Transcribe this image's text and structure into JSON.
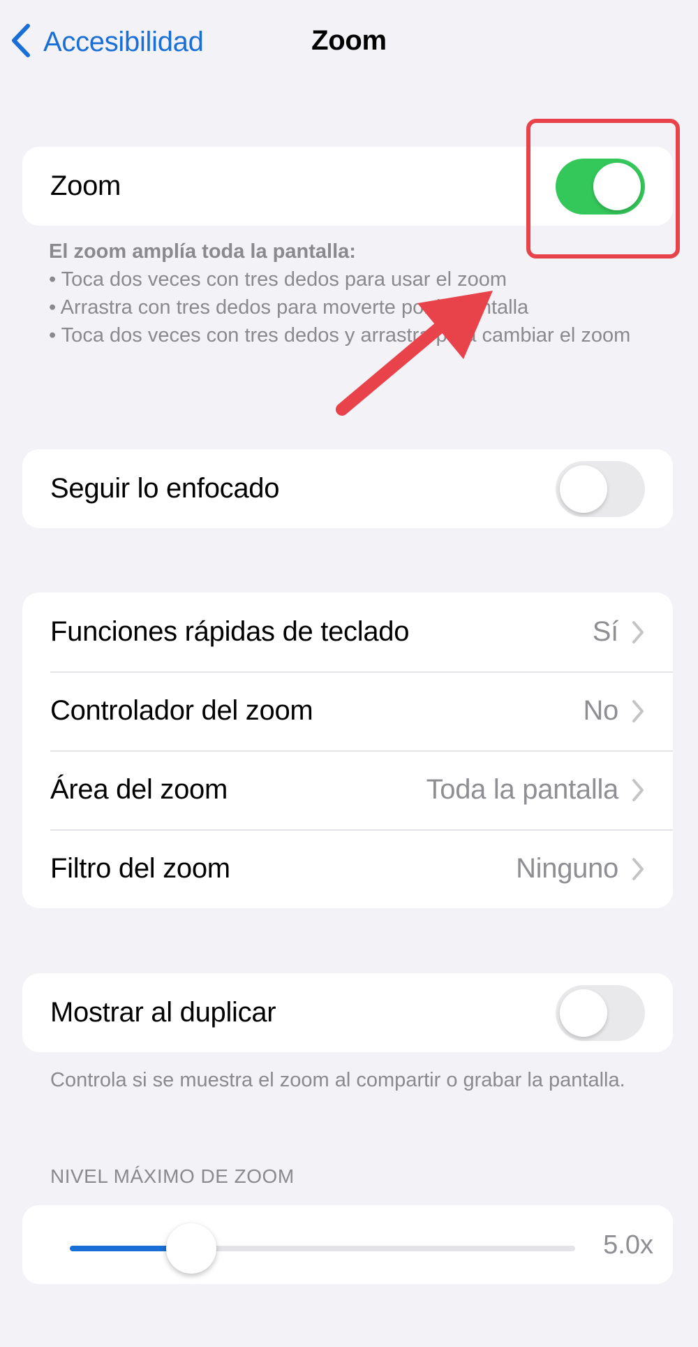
{
  "navbar": {
    "back_label": "Accesibilidad",
    "title": "Zoom"
  },
  "zoom_section": {
    "label": "Zoom",
    "toggle_on": true,
    "footnote_title": "El zoom amplía toda la pantalla:",
    "footnote_items": [
      "•  Toca dos veces con tres dedos para usar el zoom",
      "•  Arrastra con tres dedos para moverte por la pantalla",
      "•  Toca dos veces con tres dedos y arrastra para cambiar el zoom"
    ]
  },
  "follow_focus": {
    "label": "Seguir lo enfocado",
    "toggle_on": false
  },
  "settings_list": [
    {
      "label": "Funciones rápidas de teclado",
      "value": "Sí"
    },
    {
      "label": "Controlador del zoom",
      "value": "No"
    },
    {
      "label": "Área del zoom",
      "value": "Toda la pantalla"
    },
    {
      "label": "Filtro del zoom",
      "value": "Ninguno"
    }
  ],
  "mirror_section": {
    "label": "Mostrar al duplicar",
    "toggle_on": false,
    "footnote": "Controla si se muestra el zoom al compartir o grabar la pantalla."
  },
  "max_zoom": {
    "header": "NIVEL MÁXIMO DE ZOOM",
    "value_label": "5.0x",
    "slider_fraction": 0.24
  },
  "colors": {
    "accent_blue": "#1a6fd6",
    "toggle_green": "#34c759",
    "annotation_red": "#e8434b",
    "background": "#f2f2f7"
  },
  "icons": {
    "back": "chevron-left-icon",
    "row_disclosure": "chevron-right-icon",
    "annotation": "arrow-icon"
  }
}
